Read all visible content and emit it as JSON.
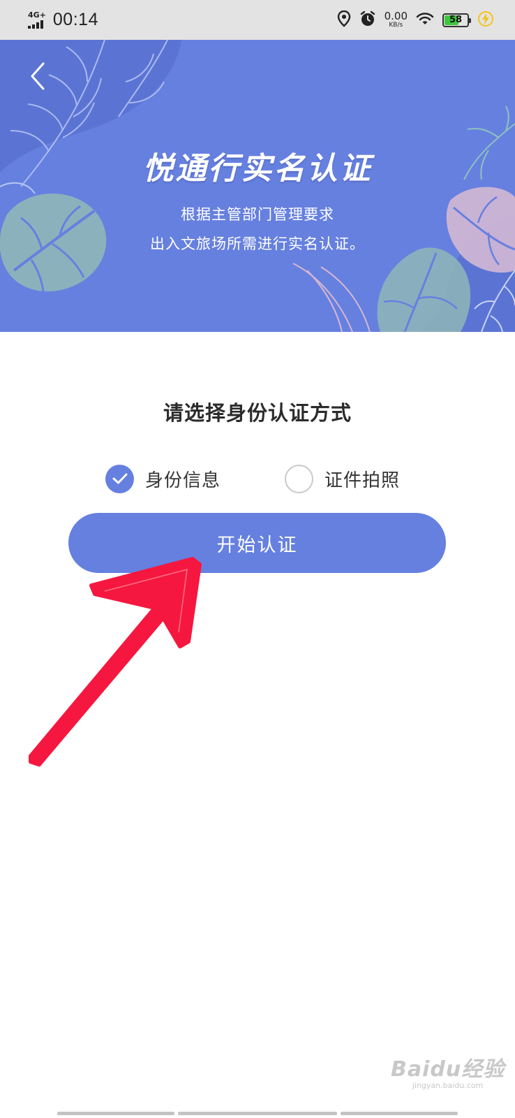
{
  "status_bar": {
    "network": "4G+",
    "time": "00:14",
    "speed_value": "0.00",
    "speed_unit": "KB/s",
    "battery_level": "58",
    "battery_fraction": 0.58,
    "icons": [
      "location-icon",
      "alarm-icon",
      "wifi-icon",
      "charging-icon"
    ]
  },
  "banner": {
    "title": "悦通行实名认证",
    "subtitle_line1": "根据主管部门管理要求",
    "subtitle_line2": "出入文旅场所需进行实名认证。",
    "background_color": "#6680e0"
  },
  "auth": {
    "prompt": "请选择身份认证方式",
    "options": [
      {
        "label": "身份信息",
        "selected": true
      },
      {
        "label": "证件拍照",
        "selected": false
      }
    ],
    "start_button": "开始认证"
  },
  "colors": {
    "accent": "#6680e0",
    "annotation_arrow": "#f5173f"
  },
  "watermark": {
    "brand": "Baidu经验",
    "url": "jingyan.baidu.com"
  }
}
